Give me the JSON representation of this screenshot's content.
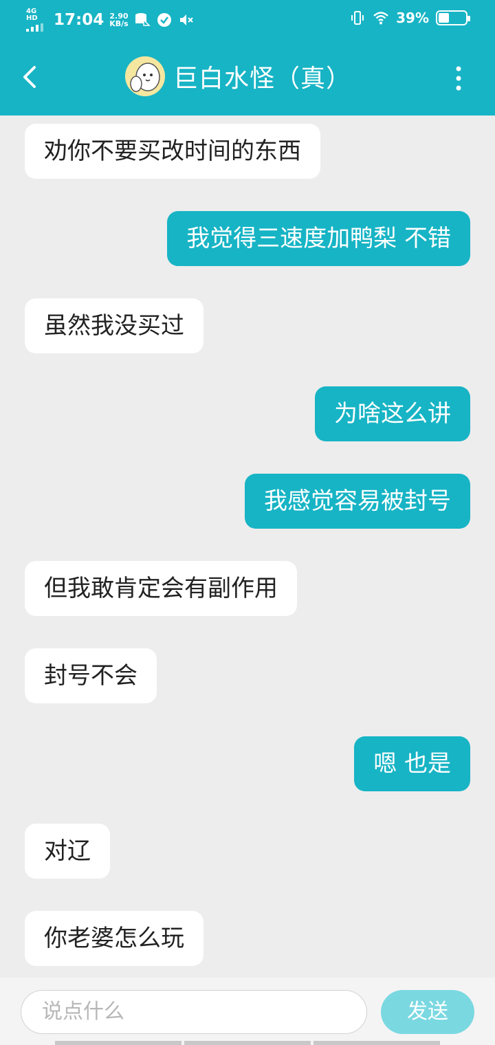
{
  "status_bar": {
    "network": "4G HD",
    "time": "17:04",
    "speed_value": "2.90",
    "speed_unit": "KB/s",
    "battery_percent": "39%",
    "battery_level": 0.39,
    "icons": [
      "signal-icon",
      "data-saver-icon",
      "check-circle-icon",
      "mute-icon",
      "vibrate-icon",
      "wifi-icon",
      "battery-icon"
    ]
  },
  "header": {
    "title": "巨白水怪（真）",
    "back_icon": "chevron-left-icon",
    "menu_icon": "more-vertical-icon",
    "accent_color": "#17b4c5"
  },
  "messages": [
    {
      "side": "left",
      "text": "劝你不要买改时间的东西"
    },
    {
      "side": "right",
      "text": "我觉得三速度加鸭梨 不错"
    },
    {
      "side": "left",
      "text": "虽然我没买过"
    },
    {
      "side": "right",
      "text": "为啥这么讲"
    },
    {
      "side": "right",
      "text": "我感觉容易被封号"
    },
    {
      "side": "left",
      "text": "但我敢肯定会有副作用"
    },
    {
      "side": "left",
      "text": "封号不会"
    },
    {
      "side": "right",
      "text": "嗯 也是"
    },
    {
      "side": "left",
      "text": "对辽"
    },
    {
      "side": "left",
      "text": "你老婆怎么玩"
    }
  ],
  "composer": {
    "placeholder": "说点什么",
    "send_label": "发送"
  }
}
